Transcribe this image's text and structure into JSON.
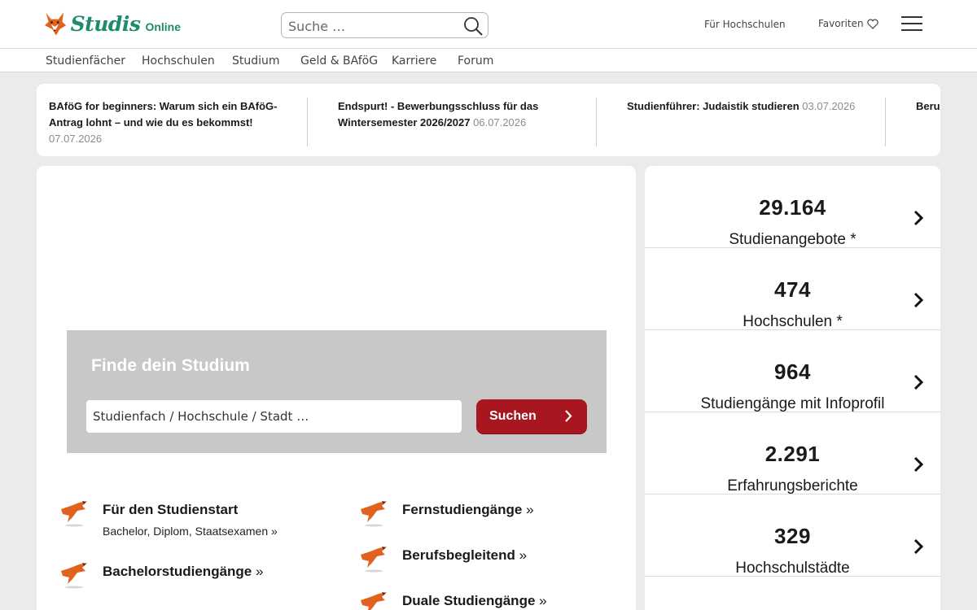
{
  "header": {
    "logo_text": "Studis",
    "logo_suffix": "Online",
    "search_placeholder": "Suche …",
    "link_hochschulen": "Für Hochschulen",
    "link_favoriten": "Favoriten"
  },
  "nav": {
    "items": [
      "Studienfächer",
      "Hochschulen",
      "Studium",
      "Geld & BAföG",
      "Karriere",
      "Forum"
    ]
  },
  "news": [
    {
      "title": "BAföG for beginners: Warum sich ein BAföG-Antrag lohnt – und wie du es bekommst!",
      "date": "07.07.2026"
    },
    {
      "title": "Endspurt! - Bewerbungsschluss für das Wintersemester 2026/2027",
      "date": "06.07.2026"
    },
    {
      "title": "Studienführer: Judaistik studieren",
      "date": "03.07.2026"
    },
    {
      "title": "Beru",
      "date": ""
    }
  ],
  "finder": {
    "title": "Finde dein Studium",
    "placeholder": "Studienfach / Hochschule / Stadt …",
    "button": "Suchen"
  },
  "categories": [
    {
      "title": "Für den Studienstart",
      "sub": "Bachelor, Diplom, Staatsexamen",
      "arrow": "»"
    },
    {
      "title": "Bachelorstudiengänge",
      "arrow": "»"
    },
    {
      "title": "Fernstudiengänge",
      "arrow": "»"
    },
    {
      "title": "Berufsbegleitend",
      "arrow": "»"
    },
    {
      "title": "Duale Studiengänge",
      "arrow": "»"
    }
  ],
  "stats": [
    {
      "number": "29.164",
      "label": "Studienangebote *"
    },
    {
      "number": "474",
      "label": "Hochschulen *"
    },
    {
      "number": "964",
      "label": "Studiengänge mit Infoprofil"
    },
    {
      "number": "2.291",
      "label": "Erfahrungsberichte"
    },
    {
      "number": "329",
      "label": "Hochschulstädte"
    }
  ],
  "colors": {
    "brand_green": "#1e8a6e",
    "accent_red": "#a8161f",
    "fox_orange": "#e0621e"
  }
}
